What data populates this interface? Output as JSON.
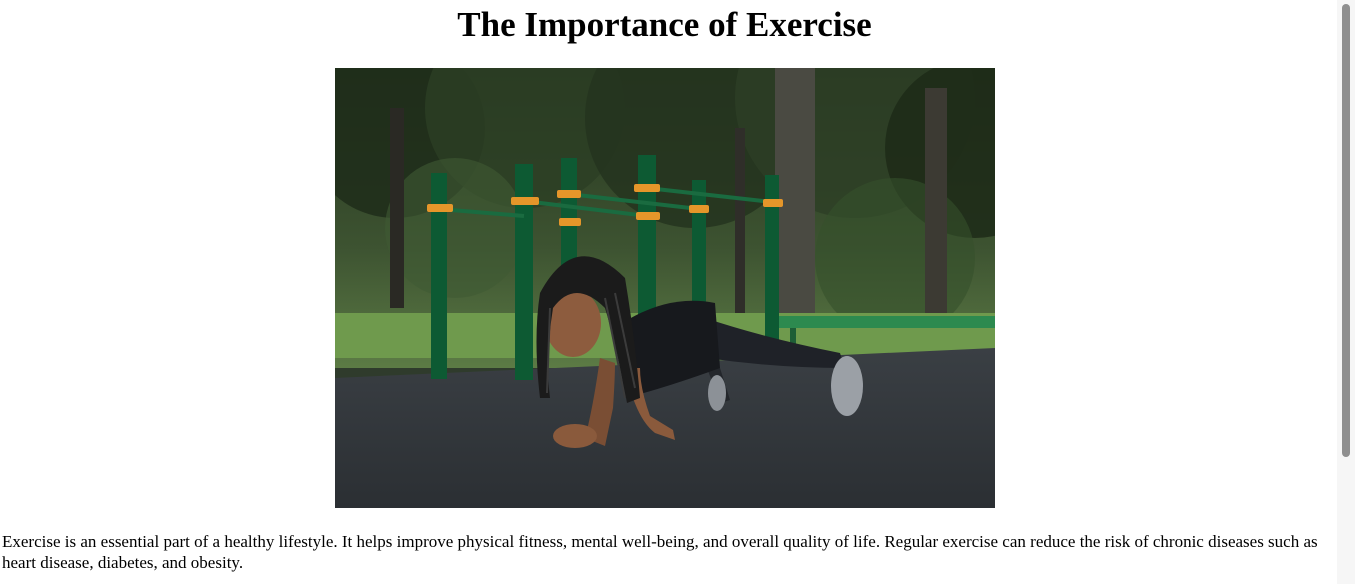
{
  "article": {
    "title": "The Importance of Exercise",
    "image_subject": "woman doing plank on outdoor park fitness court",
    "intro": "Exercise is an essential part of a healthy lifestyle. It helps improve physical fitness, mental well-being, and overall quality of life. Regular exercise can reduce the risk of chronic diseases such as heart disease, diabetes, and obesity."
  },
  "colors": {
    "page_background": "#ffffff",
    "text": "#000000",
    "scrollbar_track": "#f6f6f6",
    "scrollbar_thumb": "#8f8f8f"
  }
}
